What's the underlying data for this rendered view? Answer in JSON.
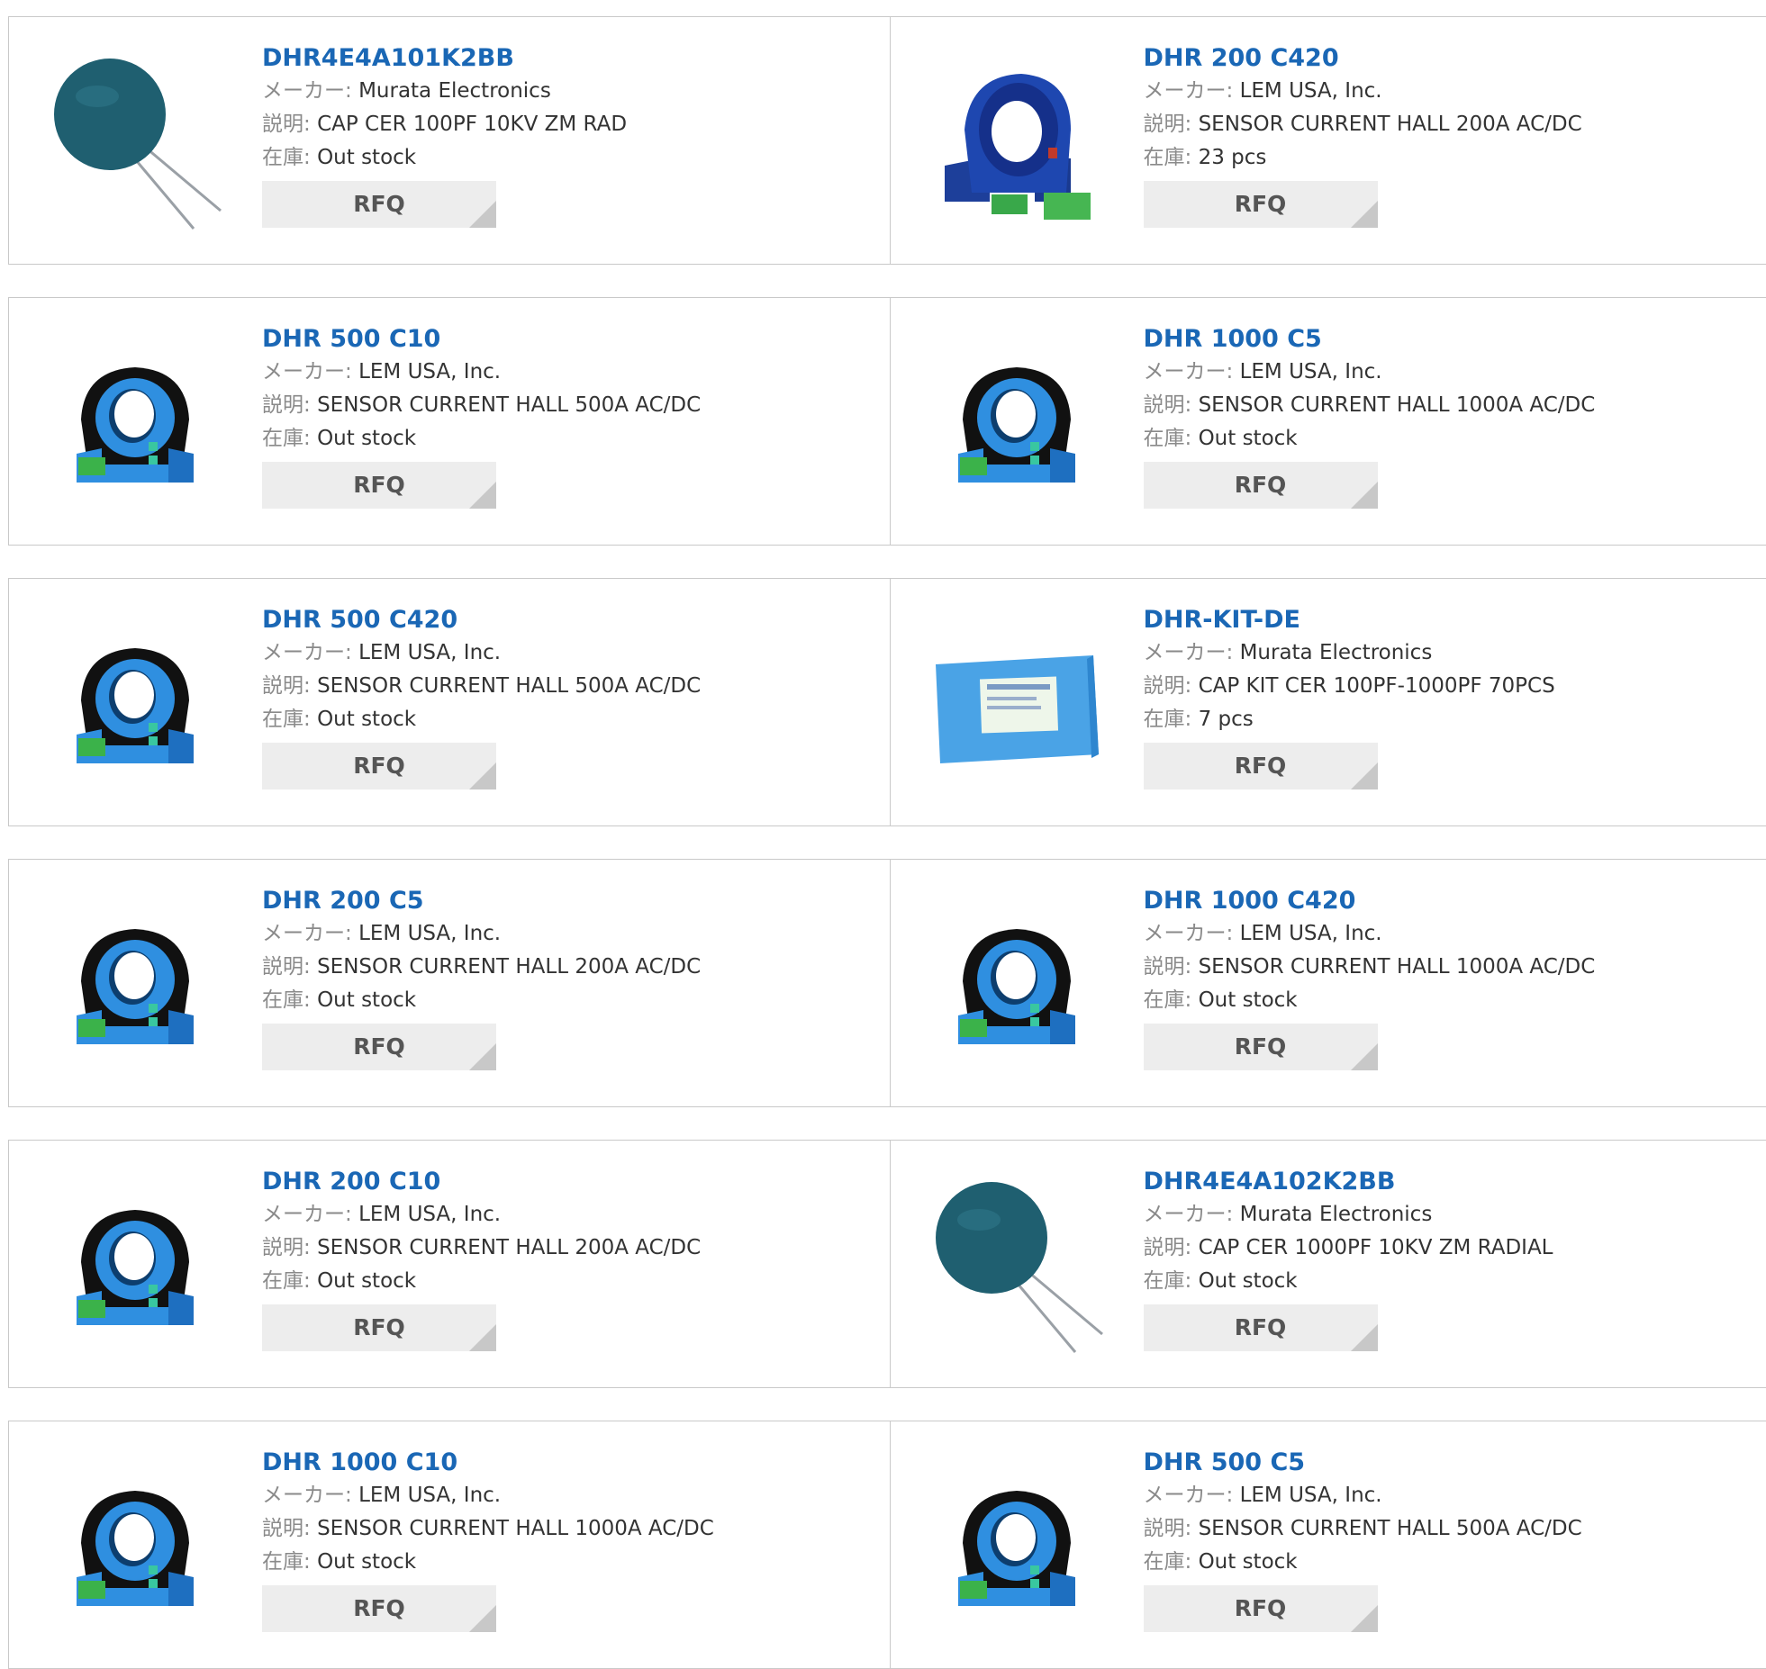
{
  "labels": {
    "maker": "メーカー:",
    "description": "説明:",
    "stock": "在庫:",
    "rfq": "RFQ"
  },
  "colors": {
    "title_link": "#1a67b5",
    "sensor_body": "#2f8fe0",
    "capacitor_body": "#1f5f70",
    "kit_box": "#4aa3e6",
    "button_bg": "#ededed"
  },
  "products": [
    {
      "name": "DHR4E4A101K2BB",
      "maker": "Murata Electronics",
      "description": "CAP CER 100PF 10KV ZM RAD",
      "stock": "Out stock",
      "image": "disc-capacitor"
    },
    {
      "name": "DHR 200 C420",
      "maker": "LEM USA, Inc.",
      "description": "SENSOR CURRENT HALL 200A AC/DC",
      "stock": "23 pcs",
      "image": "hall-sensor-dark"
    },
    {
      "name": "DHR 500 C10",
      "maker": "LEM USA, Inc.",
      "description": "SENSOR CURRENT HALL 500A AC/DC",
      "stock": "Out stock",
      "image": "hall-sensor"
    },
    {
      "name": "DHR 1000 C5",
      "maker": "LEM USA, Inc.",
      "description": "SENSOR CURRENT HALL 1000A AC/DC",
      "stock": "Out stock",
      "image": "hall-sensor"
    },
    {
      "name": "DHR 500 C420",
      "maker": "LEM USA, Inc.",
      "description": "SENSOR CURRENT HALL 500A AC/DC",
      "stock": "Out stock",
      "image": "hall-sensor"
    },
    {
      "name": "DHR-KIT-DE",
      "maker": "Murata Electronics",
      "description": "CAP KIT CER 100PF-1000PF 70PCS",
      "stock": "7 pcs",
      "image": "kit-box"
    },
    {
      "name": "DHR 200 C5",
      "maker": "LEM USA, Inc.",
      "description": "SENSOR CURRENT HALL 200A AC/DC",
      "stock": "Out stock",
      "image": "hall-sensor"
    },
    {
      "name": "DHR 1000 C420",
      "maker": "LEM USA, Inc.",
      "description": "SENSOR CURRENT HALL 1000A AC/DC",
      "stock": "Out stock",
      "image": "hall-sensor"
    },
    {
      "name": "DHR 200 C10",
      "maker": "LEM USA, Inc.",
      "description": "SENSOR CURRENT HALL 200A AC/DC",
      "stock": "Out stock",
      "image": "hall-sensor"
    },
    {
      "name": "DHR4E4A102K2BB",
      "maker": "Murata Electronics",
      "description": "CAP CER 1000PF 10KV ZM RADIAL",
      "stock": "Out stock",
      "image": "disc-capacitor"
    },
    {
      "name": "DHR 1000 C10",
      "maker": "LEM USA, Inc.",
      "description": "SENSOR CURRENT HALL 1000A AC/DC",
      "stock": "Out stock",
      "image": "hall-sensor"
    },
    {
      "name": "DHR 500 C5",
      "maker": "LEM USA, Inc.",
      "description": "SENSOR CURRENT HALL 500A AC/DC",
      "stock": "Out stock",
      "image": "hall-sensor"
    }
  ]
}
